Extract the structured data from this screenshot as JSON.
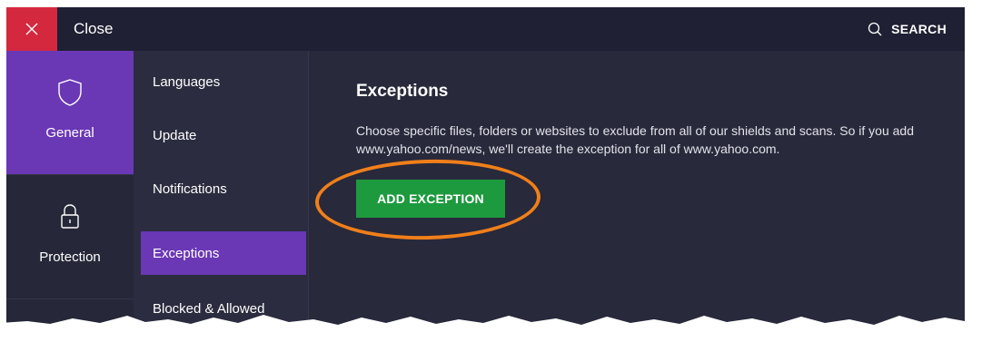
{
  "header": {
    "close_label": "Close",
    "search_label": "SEARCH"
  },
  "left_nav": {
    "items": [
      {
        "label": "General",
        "icon": "shield-icon",
        "active": true
      },
      {
        "label": "Protection",
        "icon": "lock-icon",
        "active": false
      }
    ]
  },
  "sub_nav": {
    "items": [
      {
        "label": "Languages",
        "active": false
      },
      {
        "label": "Update",
        "active": false
      },
      {
        "label": "Notifications",
        "active": false
      },
      {
        "label": "Exceptions",
        "active": true
      },
      {
        "label": "Blocked & Allowed apps",
        "active": false
      }
    ]
  },
  "main": {
    "title": "Exceptions",
    "description": "Choose specific files, folders or websites to exclude from all of our shields and scans. So if you add www.yahoo.com/news, we'll create the exception for all of www.yahoo.com.",
    "add_button_label": "ADD EXCEPTION"
  },
  "colors": {
    "accent_purple": "#6a38b5",
    "close_red": "#d4283f",
    "button_green": "#1e9a3e",
    "highlight_orange": "#f07f1a",
    "background": "#28293b"
  }
}
